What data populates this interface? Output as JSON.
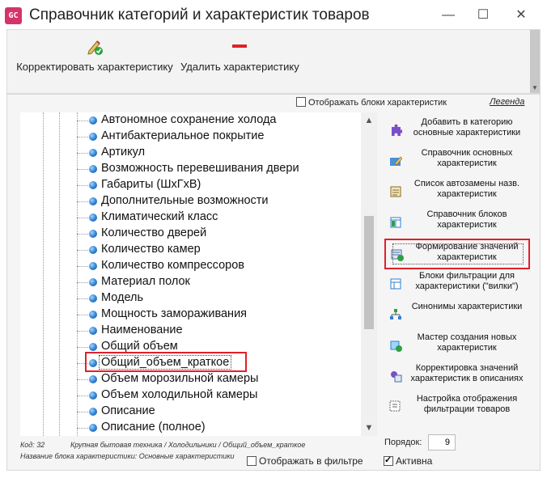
{
  "window": {
    "icon_text": "GC",
    "title": "Справочник категорий и характеристик товаров",
    "minimize_glyph": "—",
    "maximize_glyph": "☐",
    "close_glyph": "✕"
  },
  "toolbar": {
    "edit_label": "Корректировать характеристику",
    "edit_icon": "pencil-check-icon",
    "delete_label": "Удалить характеристику",
    "delete_icon": "red-dash-icon"
  },
  "options": {
    "show_blocks_label": "Отображать блоки характеристик",
    "show_blocks_checked": false,
    "legend_link": "Легенда"
  },
  "tree": {
    "items": [
      {
        "label": "Автономное сохранение холода"
      },
      {
        "label": "Антибактериальное покрытие"
      },
      {
        "label": "Артикул"
      },
      {
        "label": "Возможность перевешивания двери"
      },
      {
        "label": "Габариты (ШхГхВ)"
      },
      {
        "label": "Дополнительные возможности"
      },
      {
        "label": "Климатический класс"
      },
      {
        "label": "Количество дверей"
      },
      {
        "label": "Количество камер"
      },
      {
        "label": "Количество компрессоров"
      },
      {
        "label": "Материал полок"
      },
      {
        "label": "Модель"
      },
      {
        "label": "Мощность замораживания"
      },
      {
        "label": "Наименование"
      },
      {
        "label": "Общий объем"
      },
      {
        "label": "Общий_объем_краткое"
      },
      {
        "label": "Объем морозильной камеры"
      },
      {
        "label": "Объем холодильной камеры"
      },
      {
        "label": "Описание"
      },
      {
        "label": "Описание (полное)"
      }
    ],
    "selected_index": 15,
    "scroll_up": "▲",
    "scroll_down": "▼"
  },
  "status": {
    "code_label": "Код: 32",
    "path": "Крупная бытовая техника / Холодильники / Общий_объем_краткое",
    "block_name": "Название блока характеристики: Основные характеристики"
  },
  "filter_option": {
    "label": "Отображать в фильтре",
    "checked": false
  },
  "actions": [
    {
      "label": "Добавить в категорию основные характеристики",
      "icon": "puzzle-plus-icon"
    },
    {
      "label": "Справочник основных характеристик",
      "icon": "edit-form-icon"
    },
    {
      "label": "Список автозамены назв. характеристик",
      "icon": "autoreplace-list-icon"
    },
    {
      "label": "Справочник блоков характеристик",
      "icon": "blocks-table-icon"
    },
    {
      "label": "Формирование значений характеристик",
      "icon": "values-generate-icon"
    },
    {
      "label": "Блоки фильтрации для характеристики (\"вилки\")",
      "icon": "filter-blocks-icon"
    },
    {
      "label": "Синонимы характеристики",
      "icon": "synonyms-tree-icon"
    },
    {
      "label": "Мастер создания новых характеристик",
      "icon": "wizard-icon"
    },
    {
      "label": "Корректировка значений характеристик в описаниях",
      "icon": "correct-values-icon"
    },
    {
      "label": "Настройка отображения фильтрации товаров",
      "icon": "filter-settings-icon"
    }
  ],
  "order": {
    "label": "Порядок:",
    "value": "9"
  },
  "active_option": {
    "label": "Активна",
    "checked": true
  },
  "colors": {
    "highlight_red": "#e0202a",
    "bullet_blue": "#2f7fd0",
    "toolbar_bg": "#f3f3f3",
    "panel_bg": "#f5f5f5"
  }
}
